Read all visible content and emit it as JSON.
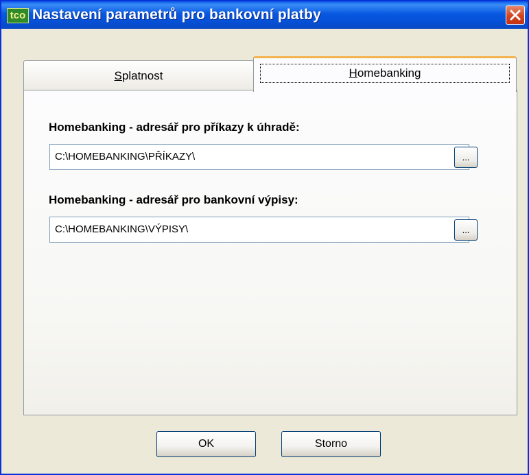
{
  "window": {
    "title": "Nastavení parametrů pro bankovní platby",
    "app_icon_text": "tco",
    "close_icon": "close-icon"
  },
  "tabs": [
    {
      "label_underlined": "S",
      "label_rest": "platnost",
      "active": false
    },
    {
      "label_underlined": "H",
      "label_rest": "omebanking",
      "active": true
    }
  ],
  "fields": [
    {
      "label": "Homebanking - adresář pro příkazy k úhradě:",
      "value": "C:\\HOMEBANKING\\PŘÍKAZY\\",
      "browse_label": "..."
    },
    {
      "label": "Homebanking - adresář pro bankovní výpisy:",
      "value": "C:\\HOMEBANKING\\VÝPISY\\",
      "browse_label": "..."
    }
  ],
  "buttons": {
    "ok_label": "OK",
    "cancel_label": "Storno"
  },
  "colors": {
    "titlebar": "#0858e1",
    "close": "#d2431f",
    "active_tab_highlight": "#f3b34e",
    "window_bg": "#ece9d8"
  }
}
